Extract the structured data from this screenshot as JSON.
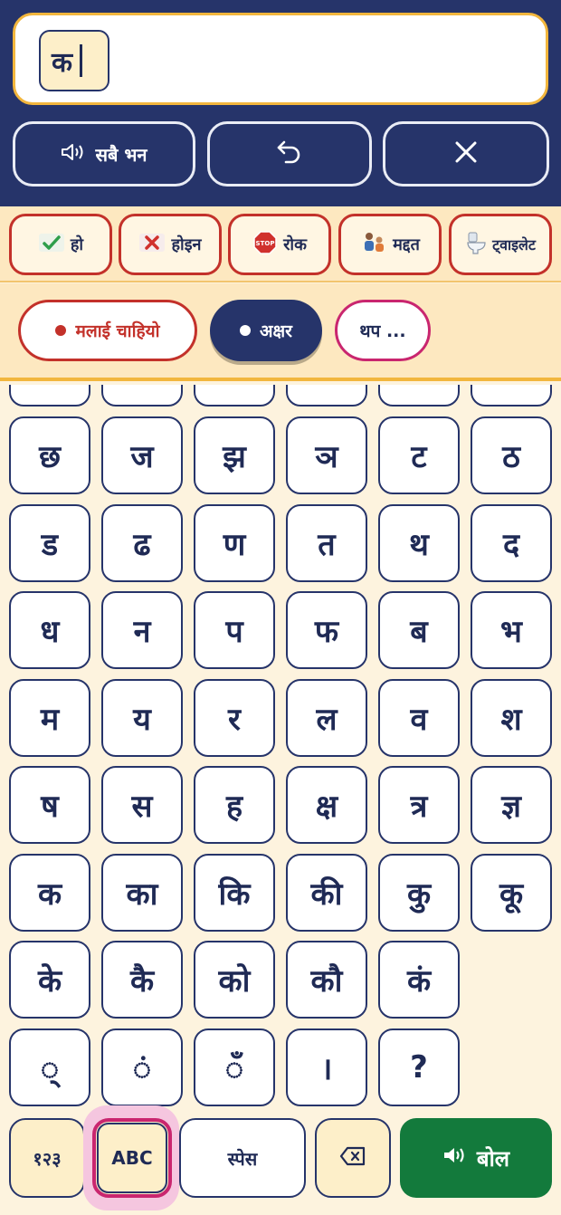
{
  "message": {
    "tokens": [
      "क"
    ]
  },
  "header_buttons": {
    "speak_all": "सबै भन",
    "undo_icon": "undo-icon",
    "clear_icon": "close-icon"
  },
  "quick_phrases": [
    {
      "label": "हो",
      "icon": "check-icon"
    },
    {
      "label": "होइन",
      "icon": "cross-icon"
    },
    {
      "label": "रोक",
      "icon": "stop-sign-icon"
    },
    {
      "label": "मद्दत",
      "icon": "help-people-icon"
    },
    {
      "label": "ट्वाइलेट",
      "icon": "toilet-icon"
    }
  ],
  "categories": {
    "want": "मलाई चाहियो",
    "letters": "अक्षर",
    "more": "थप ..."
  },
  "keys": [
    [
      "छ",
      "ज",
      "झ",
      "ञ",
      "ट",
      "ठ"
    ],
    [
      "ड",
      "ढ",
      "ण",
      "त",
      "थ",
      "द"
    ],
    [
      "ध",
      "न",
      "प",
      "फ",
      "ब",
      "भ"
    ],
    [
      "म",
      "य",
      "र",
      "ल",
      "व",
      "श"
    ],
    [
      "ष",
      "स",
      "ह",
      "क्ष",
      "त्र",
      "ज्ञ"
    ],
    [
      "क",
      "का",
      "कि",
      "की",
      "कु",
      "कू"
    ],
    [
      "के",
      "कै",
      "को",
      "कौ",
      "कं"
    ],
    [
      "्",
      "ं",
      "ँ",
      "।",
      "?"
    ]
  ],
  "bottom_bar": {
    "numbers": "१२३",
    "abc": "ABC",
    "space": "स्पेस",
    "speak": "बोल"
  },
  "colors": {
    "navy": "#26346a",
    "accent_yellow": "#f2b63d",
    "red": "#c3312a",
    "pink": "#c9266f",
    "green": "#137a3c",
    "cream": "#fdf3de"
  }
}
